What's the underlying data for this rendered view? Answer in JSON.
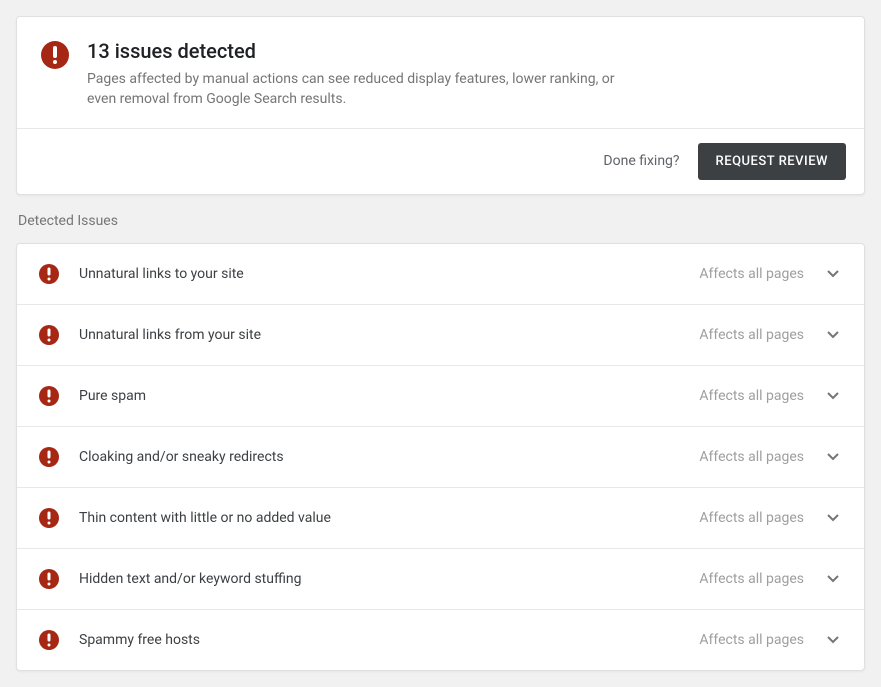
{
  "summary": {
    "title": "13 issues detected",
    "description": "Pages affected by manual actions can see reduced display features, lower ranking, or even removal from Google Search results.",
    "done_fixing_label": "Done fixing?",
    "request_review_label": "Request Review"
  },
  "section_heading": "Detected Issues",
  "issues": [
    {
      "title": "Unnatural links to your site",
      "affects": "Affects all pages"
    },
    {
      "title": "Unnatural links from your site",
      "affects": "Affects all pages"
    },
    {
      "title": "Pure spam",
      "affects": "Affects all pages"
    },
    {
      "title": "Cloaking and/or sneaky redirects",
      "affects": "Affects all pages"
    },
    {
      "title": "Thin content with little or no added value",
      "affects": "Affects all pages"
    },
    {
      "title": "Hidden text and/or keyword stuffing",
      "affects": "Affects all pages"
    },
    {
      "title": "Spammy free hosts",
      "affects": "Affects all pages"
    }
  ]
}
